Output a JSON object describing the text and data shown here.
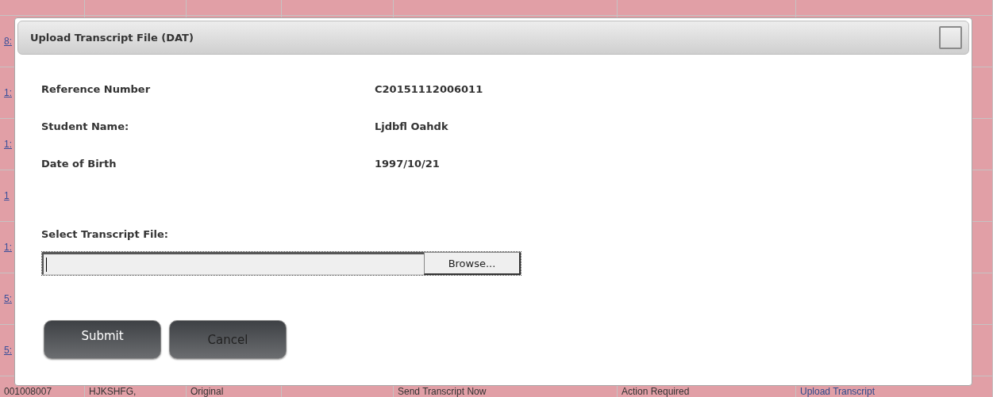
{
  "background_table": {
    "row_links": [
      "8:",
      "1:",
      "1:",
      "1",
      "1:",
      "5:",
      "5:"
    ],
    "last_row": [
      {
        "kind": "text",
        "text": "001008007"
      },
      {
        "kind": "text",
        "text": "HJKSHFG,"
      },
      {
        "kind": "text",
        "text": "Original"
      },
      {
        "kind": "empty"
      },
      {
        "kind": "text",
        "text": "Send Transcript Now"
      },
      {
        "kind": "text",
        "text": "Action Required"
      },
      {
        "kind": "link",
        "text": "Upload Transcript"
      }
    ]
  },
  "dialog": {
    "title": "Upload Transcript File (DAT)",
    "fields": [
      {
        "label": "Reference Number",
        "value": "C20151112006011"
      },
      {
        "label": "Student Name:",
        "value": "Ljdbfl Oahdk"
      },
      {
        "label": "Date of Birth",
        "value": "1997/10/21"
      }
    ],
    "file_field": {
      "label": "Select Transcript File:",
      "button": "Browse..."
    },
    "buttons": [
      {
        "label": "Submit",
        "kind": "primary"
      },
      {
        "label": "Cancel",
        "kind": "secondary"
      }
    ]
  }
}
